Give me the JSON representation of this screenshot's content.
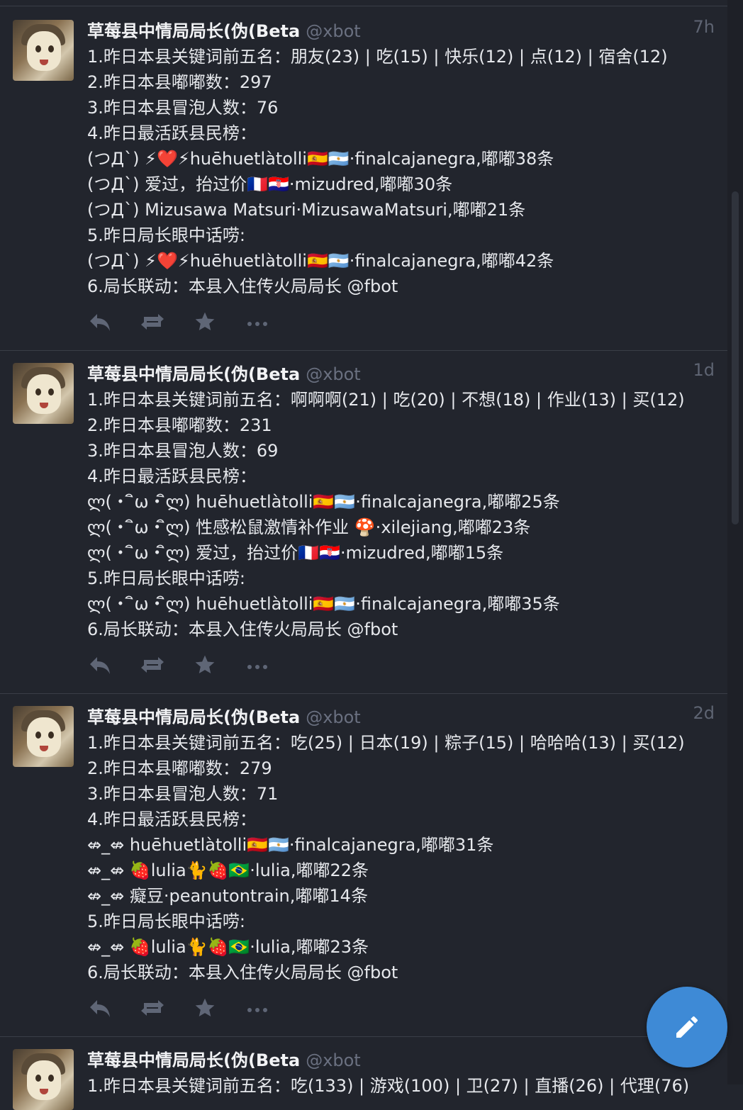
{
  "statuses": [
    {
      "name": "草莓县中情局局长(伪(Beta",
      "handle": "@xbot",
      "time": "7h",
      "lines": [
        "1.昨日本县关键词前五名：朋友(23) | 吃(15) | 快乐(12) | 点(12) | 宿舍(12)",
        "2.昨日本县嘟嘟数：297",
        "3.昨日本县冒泡人数：76",
        "4.昨日最活跃县民榜：",
        "(つД`) ⚡❤️⚡huēhuetlàtolli🇪🇸🇦🇷·finalcajanegra,嘟嘟38条",
        "(つД`) 爱过，抬过价🇫🇷🇭🇷·mizudred,嘟嘟30条",
        "(つД`) Mizusawa Matsuri·MizusawaMatsuri,嘟嘟21条",
        "5.昨日局长眼中话唠:",
        "(つД`) ⚡❤️⚡huēhuetlàtolli🇪🇸🇦🇷·finalcajanegra,嘟嘟42条",
        "6.局长联动：本县入住传火局局长 @fbot"
      ]
    },
    {
      "name": "草莓县中情局局长(伪(Beta",
      "handle": "@xbot",
      "time": "1d",
      "lines": [
        "1.昨日本县关键词前五名：啊啊啊(21) | 吃(20) | 不想(18) | 作业(13) | 买(12)",
        "2.昨日本县嘟嘟数：231",
        "3.昨日本县冒泡人数：69",
        "4.昨日最活跃县民榜：",
        "ლ(・ ิω・ิლ) huēhuetlàtolli🇪🇸🇦🇷·finalcajanegra,嘟嘟25条",
        "ლ(・ ิω・ิლ) 性感松鼠激情补作业 🍄·xilejiang,嘟嘟23条",
        "ლ(・ ิω・ิლ) 爱过，抬过价🇫🇷🇭🇷·mizudred,嘟嘟15条",
        "5.昨日局长眼中话唠:",
        "ლ(・ ิω・ิლ) huēhuetlàtolli🇪🇸🇦🇷·finalcajanegra,嘟嘟35条",
        "6.局长联动：本县入住传火局局长 @fbot"
      ]
    },
    {
      "name": "草莓县中情局局长(伪(Beta",
      "handle": "@xbot",
      "time": "2d",
      "lines": [
        "1.昨日本县关键词前五名：吃(25) | 日本(19) | 粽子(15) | 哈哈哈(13) | 买(12)",
        "2.昨日本县嘟嘟数：279",
        "3.昨日本县冒泡人数：71",
        "4.昨日最活跃县民榜：",
        "⇎_⇎ huēhuetlàtolli🇪🇸🇦🇷·finalcajanegra,嘟嘟31条",
        "⇎_⇎ 🍓lulia🐈🍓🇧🇷·lulia,嘟嘟22条",
        "⇎_⇎ 癡豆·peanutontrain,嘟嘟14条",
        "5.昨日局长眼中话唠:",
        "⇎_⇎ 🍓lulia🐈🍓🇧🇷·lulia,嘟嘟23条",
        "6.局长联动：本县入住传火局局长 @fbot"
      ]
    },
    {
      "name": "草莓县中情局局长(伪(Beta",
      "handle": "@xbot",
      "time": "",
      "lines": [
        "1.昨日本县关键词前五名：吃(133) | 游戏(100) | 卫(27) | 直播(26) | 代理(76)"
      ]
    }
  ],
  "icons": {
    "reply": "reply-icon",
    "boost": "boost-icon",
    "favourite": "star-icon",
    "more": "more-icon",
    "compose": "pencil-icon"
  },
  "colors": {
    "background": "#22252d",
    "accent": "#3e8ad6",
    "muted": "#6a7080"
  }
}
